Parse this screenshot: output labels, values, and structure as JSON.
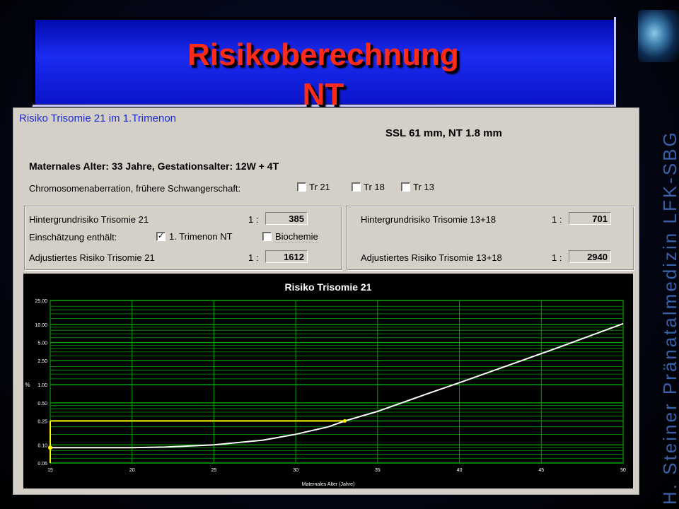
{
  "slide": {
    "title_line1": "Risikoberechnung",
    "title_line2": "NT",
    "credit": "H. Steiner   Pränatalmedizin  LFK-SBG"
  },
  "app": {
    "heading": "Risiko Trisomie 21 im 1.Trimenon",
    "ssl": "SSL 61 mm, NT 1.8 mm",
    "maternal_info": "Maternales Alter: 33 Jahre,  Gestationsalter: 12W + 4T",
    "chrom_label": "Chromosomenaberration, frühere Schwangerschaft:",
    "chrom_options": [
      {
        "label": "Tr 21",
        "checked": false
      },
      {
        "label": "Tr 18",
        "checked": false
      },
      {
        "label": "Tr 13",
        "checked": false
      }
    ],
    "left_group": {
      "background_label": "Hintergrundrisiko Trisomie 21",
      "ratio_prefix": "1 :",
      "background_value": "385",
      "estimate_label": "Einschätzung enthält:",
      "option_nt": {
        "label": "1. Trimenon NT",
        "checked": true
      },
      "option_bio": {
        "label": "Biochemie",
        "checked": false
      },
      "adjusted_label": "Adjustiertes Risiko Trisomie 21",
      "adjusted_value": "1612"
    },
    "right_group": {
      "background_label": "Hintergrundrisiko Trisomie 13+18",
      "ratio_prefix": "1 :",
      "background_value": "701",
      "adjusted_label": "Adjustiertes Risiko Trisomie 13+18",
      "adjusted_value": "2940"
    }
  },
  "colors": {
    "title_red": "#ff2a1a",
    "banner_blue": "#1a2cf0",
    "grid_green": "#00a000",
    "curve": "#ffffff",
    "marker": "#ffff00"
  },
  "chart_data": {
    "type": "line",
    "title": "Risiko Trisomie 21",
    "xlabel": "Maternales Alter (Jahre)",
    "ylabel": "%",
    "y_scale": "log",
    "xlim": [
      15,
      50
    ],
    "ylim": [
      0.05,
      25
    ],
    "x_ticks": [
      "15",
      "20",
      "25",
      "30",
      "35",
      "40",
      "45",
      "50"
    ],
    "y_ticks": [
      "0.05",
      "0.10",
      "0.25",
      "0.50",
      "1.00",
      "2.50",
      "5.00",
      "10.00",
      "25.00"
    ],
    "series": [
      {
        "x": [
          15,
          20,
          22,
          25,
          28,
          30,
          32,
          33,
          35,
          38,
          40,
          43,
          46,
          50
        ],
        "y": [
          0.09,
          0.09,
          0.092,
          0.1,
          0.12,
          0.15,
          0.2,
          0.25,
          0.36,
          0.7,
          1.08,
          2.1,
          4.1,
          10.3
        ]
      }
    ],
    "marker": {
      "x": 33,
      "y": 0.25
    },
    "ygrid_minor": [
      0.06,
      0.07,
      0.08,
      0.09,
      0.15,
      0.2,
      0.3,
      0.35,
      0.4,
      0.45,
      1.25,
      1.5,
      1.75,
      2,
      3,
      3.5,
      4,
      4.5,
      6,
      7,
      8,
      9,
      12.5,
      15,
      17.5,
      20
    ],
    "grid": true
  }
}
